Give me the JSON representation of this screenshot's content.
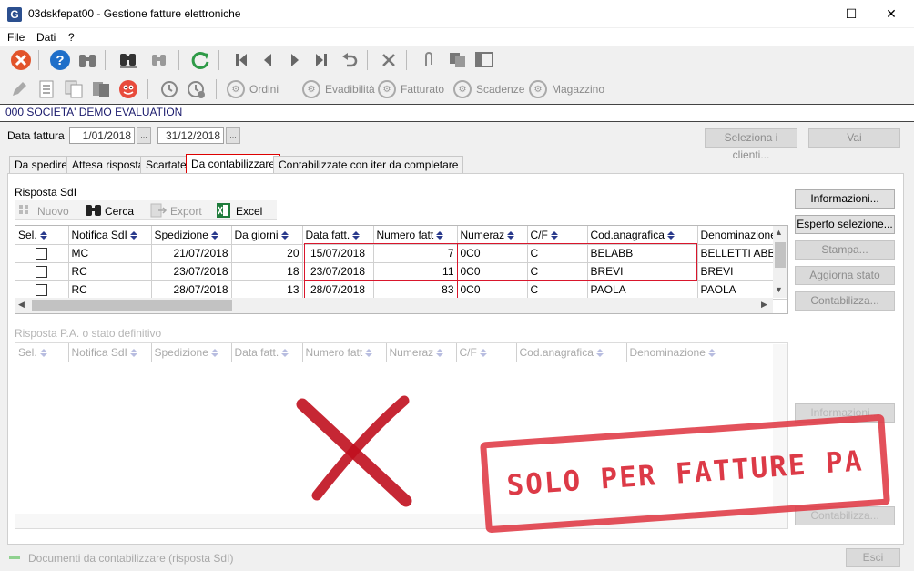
{
  "window": {
    "title": "03dskfepat00 - Gestione fatture elettroniche",
    "icon_letter": "G",
    "controls": [
      "—",
      "☐",
      "✕"
    ]
  },
  "menu": [
    "File",
    "Dati",
    "?"
  ],
  "toolbar2": {
    "ordini": "Ordini",
    "evadibilita": "Evadibilità",
    "fatturato": "Fatturato",
    "scadenze": "Scadenze",
    "magazzino": "Magazzino"
  },
  "company": "000 SOCIETA' DEMO EVALUATION",
  "filter": {
    "label": "Data fattura",
    "from": "1/01/2018",
    "to": "31/12/2018",
    "dots": "...",
    "select_clients": "Seleziona i clienti...",
    "go": "Vai"
  },
  "tabs": [
    "Da spedire",
    "Attesa risposta",
    "Scartate",
    "Da contabilizzare",
    "Contabilizzate con iter da completare"
  ],
  "active_tab": "Da contabilizzare",
  "sdi": {
    "label": "Risposta SdI",
    "actions": {
      "new": "Nuovo",
      "search": "Cerca",
      "export": "Export",
      "excel": "Excel"
    },
    "columns": [
      "Sel.",
      "Notifica SdI",
      "Spedizione",
      "Da giorni",
      "Data fatt.",
      "Numero fatt",
      "Numeraz",
      "C/F",
      "Cod.anagrafica",
      "Denominazione"
    ],
    "rows": [
      {
        "notifica": "MC",
        "spedizione": "21/07/2018",
        "giorni": "20",
        "data": "15/07/2018",
        "numero": "7",
        "numeraz": "0C0",
        "cf": "C",
        "cod": "BELABB",
        "denom": "BELLETTI ABBIGLIAMENTO"
      },
      {
        "notifica": "RC",
        "spedizione": "23/07/2018",
        "giorni": "18",
        "data": "23/07/2018",
        "numero": "11",
        "numeraz": "0C0",
        "cf": "C",
        "cod": "BREVI",
        "denom": "BREVI"
      },
      {
        "notifica": "RC",
        "spedizione": "28/07/2018",
        "giorni": "13",
        "data": "28/07/2018",
        "numero": "83",
        "numeraz": "0C0",
        "cf": "C",
        "cod": "PAOLA",
        "denom": "PAOLA"
      }
    ]
  },
  "side_buttons": [
    "Informazioni...",
    "Esperto selezione...",
    "Stampa...",
    "Aggiorna stato",
    "Contabilizza..."
  ],
  "pa": {
    "label": "Risposta P.A. o stato definitivo",
    "columns": [
      "Sel.",
      "Notifica SdI",
      "Spedizione",
      "Data fatt.",
      "Numero fatt",
      "Numeraz",
      "C/F",
      "Cod.anagrafica",
      "Denominazione"
    ],
    "side_buttons": [
      "Informazioni...",
      "Contabilizza..."
    ]
  },
  "stamp": "SOLO PER FATTURE PA",
  "status": {
    "text": "Documenti da contabilizzare (risposta SdI)",
    "exit": "Esci"
  },
  "colors": {
    "accent_red": "#d9162c",
    "stamp_red": "#d81f2e",
    "company_text": "#1a1a6c"
  }
}
